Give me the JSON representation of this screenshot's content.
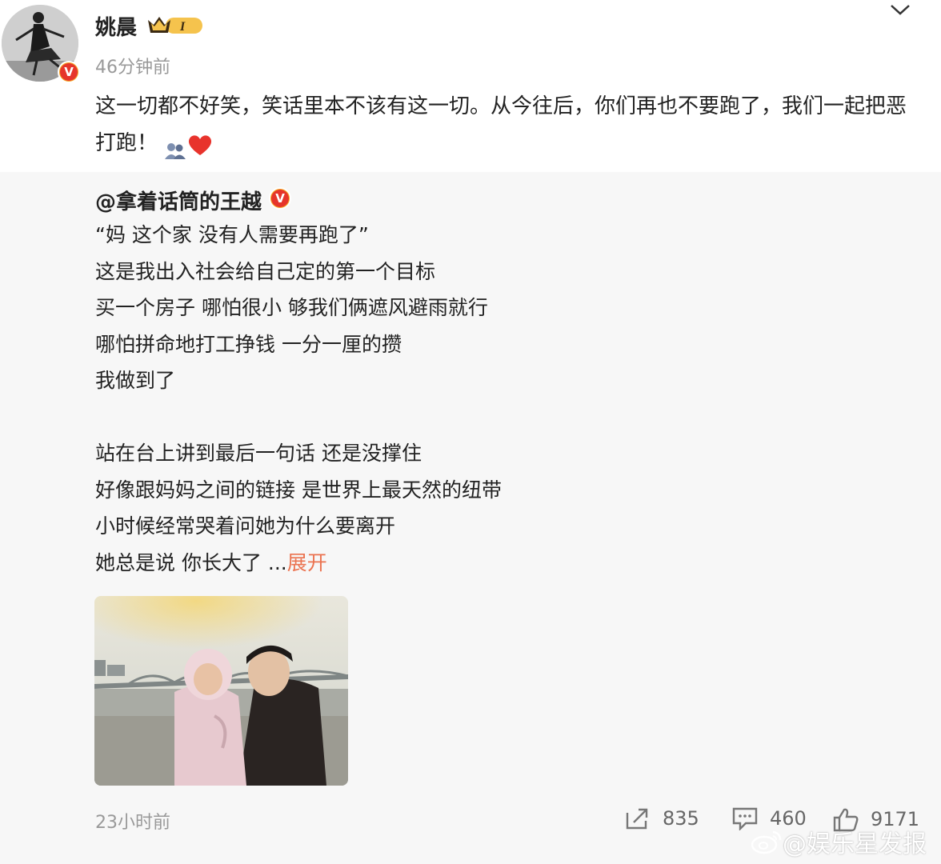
{
  "post": {
    "author": "姚晨",
    "level_badge": "I",
    "time": "46分钟前",
    "text": "这一切都不好笑，笑话里本不该有这一切。从今往后，你们再也不要跑了，我们一起把恶打跑！"
  },
  "repost": {
    "user": "@拿着话筒的王越",
    "lines": [
      "“妈 这个家 没有人需要再跑了”",
      "这是我出入社会给自己定的第一个目标",
      "买一个房子 哪怕很小 够我们俩遮风避雨就行",
      "哪怕拼命地打工挣钱 一分一厘的攒",
      "我做到了",
      "",
      "站在台上讲到最后一句话 还是没撑住",
      "好像跟妈妈之间的链接 是世界上最天然的纽带",
      "小时候经常哭着问她为什么要离开"
    ],
    "last_line": "她总是说 你长大了 ...",
    "expand_label": "展开",
    "time": "23小时前",
    "reposts": "835",
    "comments": "460",
    "likes": "9171"
  },
  "watermark": "@娱乐星发报",
  "colors": {
    "background": "#ffffff",
    "repost_background": "#f7f7f7",
    "expand_link": "#eb7350",
    "muted_text": "#999999",
    "verified_badge": "#f6a623"
  },
  "icons": [
    "chevron-down-icon",
    "verified-icon",
    "crown-icon",
    "people-emoji-icon",
    "heart-emoji-icon",
    "repost-icon",
    "comment-icon",
    "like-icon",
    "weibo-logo-icon"
  ]
}
